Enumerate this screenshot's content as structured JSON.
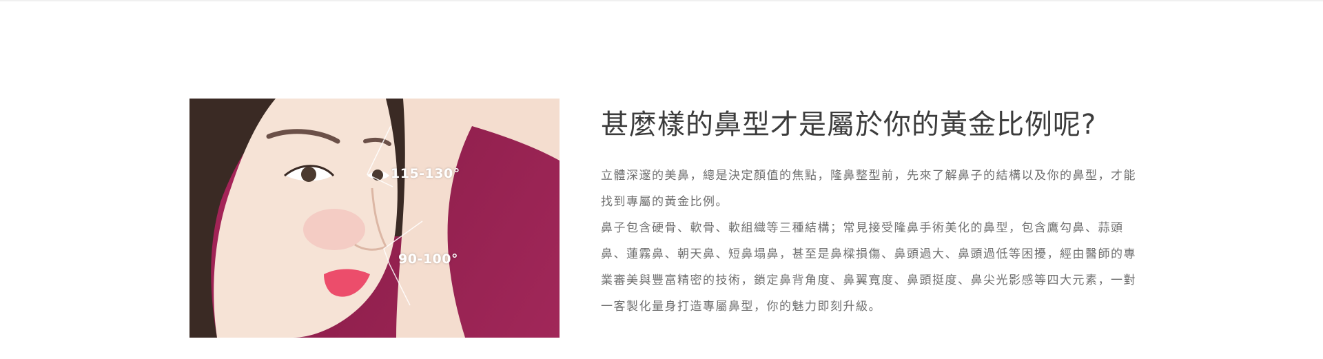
{
  "article": {
    "image_labels": {
      "upper_angle": "115-130°",
      "lower_angle": "90-100°"
    },
    "headline": "甚麼樣的鼻型才是屬於你的黃金比例呢?",
    "paragraphs": [
      "立體深邃的美鼻，總是決定顏值的焦點，隆鼻整型前，先來了解鼻子的結構以及你的鼻型，才能找到專屬的黃金比例。",
      "鼻子包含硬骨、軟骨、軟組織等三種結構；常見接受隆鼻手術美化的鼻型，包含鷹勾鼻、蒜頭鼻、蓮霧鼻、朝天鼻、短鼻塌鼻，甚至是鼻樑損傷、鼻頭過大、鼻頭過低等困擾，經由醫師的專業審美與豐富精密的技術，鎖定鼻背角度、鼻翼寬度、鼻頭挺度、鼻尖光影感等四大元素，一對一客製化量身打造專屬鼻型，你的魅力即刻升級。"
    ]
  }
}
